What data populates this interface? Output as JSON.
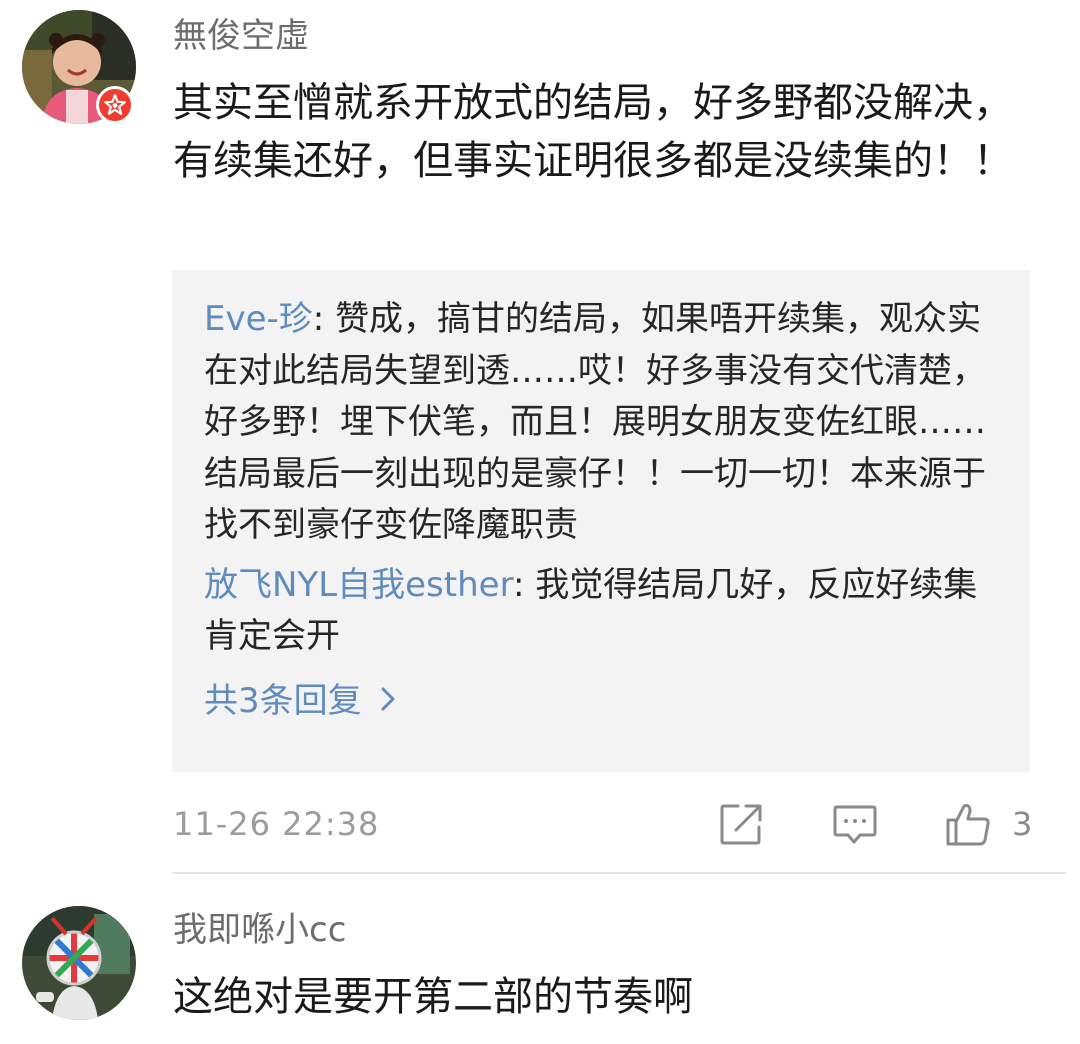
{
  "comments": [
    {
      "username": "無俊空虛",
      "text": "其实至憎就系开放式的结局，好多野都没解决，有续集还好，但事实证明很多都是没续集的！！",
      "replies": [
        {
          "author": "Eve-珍",
          "separator": ": ",
          "text": "赞成，搞甘的结局，如果唔开续集，观众实在对此结局失望到透……哎！好多事没有交代清楚，好多野！埋下伏笔，而且！展明女朋友变佐红眼……结局最后一刻出现的是豪仔！！一切一切！本来源于找不到豪仔变佐降魔职责"
        },
        {
          "author": "放飞NYL自我esther",
          "separator": ": ",
          "text": "我觉得结局几好，反应好续集肯定会开"
        }
      ],
      "more_replies_label": "共3条回复",
      "timestamp": "11-26 22:38",
      "like_count": "3",
      "icons": {
        "share": "share-icon",
        "comment": "comment-icon",
        "like": "thumbs-up-icon",
        "more": "chevron-right-icon",
        "badge": "vip-star-icon"
      }
    },
    {
      "username": "我即喺小cc",
      "text": "这绝对是要开第二部的节奏啊"
    }
  ],
  "colors": {
    "link": "#5f8bbd",
    "username": "#6d6d6d",
    "body_text": "#1a1a1a",
    "meta": "#9b9b9b",
    "reply_bg": "#f3f3f4",
    "badge": "#ee3c2f",
    "divider": "#e6e6e6"
  }
}
